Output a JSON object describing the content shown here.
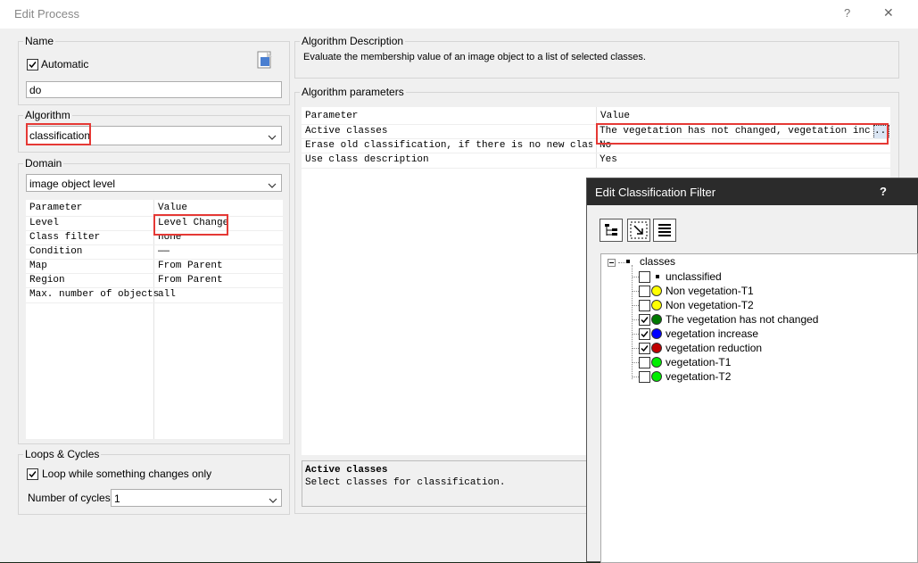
{
  "window": {
    "title": "Edit Process",
    "help": "?",
    "close": "✕"
  },
  "name_group": {
    "label": "Name",
    "automatic_label": "Automatic",
    "automatic_checked": true,
    "value": "do"
  },
  "algorithm_group": {
    "label": "Algorithm",
    "value": "classification"
  },
  "domain_group": {
    "label": "Domain",
    "value": "image object level",
    "header": [
      "Parameter",
      "Value"
    ],
    "rows": [
      {
        "param": "Level",
        "value": "Level Change"
      },
      {
        "param": "Class filter",
        "value": "none"
      },
      {
        "param": "Condition",
        "value": "——"
      },
      {
        "param": "Map",
        "value": "From Parent"
      },
      {
        "param": "Region",
        "value": "From Parent"
      },
      {
        "param": "Max. number of objects",
        "value": "all"
      }
    ]
  },
  "loops_group": {
    "label": "Loops & Cycles",
    "loop_label": "Loop while something changes only",
    "loop_checked": true,
    "cycles_label": "Number of cycles",
    "cycles_value": "1"
  },
  "description_group": {
    "label": "Algorithm Description",
    "text": "Evaluate the membership value of an image object to a list of selected classes."
  },
  "params_group": {
    "label": "Algorithm parameters",
    "header": [
      "Parameter",
      "Value"
    ],
    "rows": [
      {
        "param": "Active classes",
        "value": "The vegetation has not changed, vegetation increas..."
      },
      {
        "param": "Erase old classification, if there is no new class...",
        "value": "No"
      },
      {
        "param": "Use class description",
        "value": "Yes"
      }
    ],
    "browse": "...",
    "help_title": "Active classes",
    "help_text": "Select classes for classification."
  },
  "filter_dialog": {
    "title": "Edit Classification Filter",
    "help": "?",
    "root": "classes",
    "items": [
      {
        "label": "unclassified",
        "checked": false,
        "color": ""
      },
      {
        "label": "Non vegetation-T1",
        "checked": false,
        "color": "#ffff00"
      },
      {
        "label": "Non vegetation-T2",
        "checked": false,
        "color": "#ffff00"
      },
      {
        "label": "The vegetation has not changed",
        "checked": true,
        "color": "#007a00"
      },
      {
        "label": "vegetation increase",
        "checked": true,
        "color": "#0000ff"
      },
      {
        "label": "vegetation reduction",
        "checked": true,
        "color": "#c00000"
      },
      {
        "label": "vegetation-T1",
        "checked": false,
        "color": "#00ee00"
      },
      {
        "label": "vegetation-T2",
        "checked": false,
        "color": "#00ee00"
      }
    ]
  }
}
